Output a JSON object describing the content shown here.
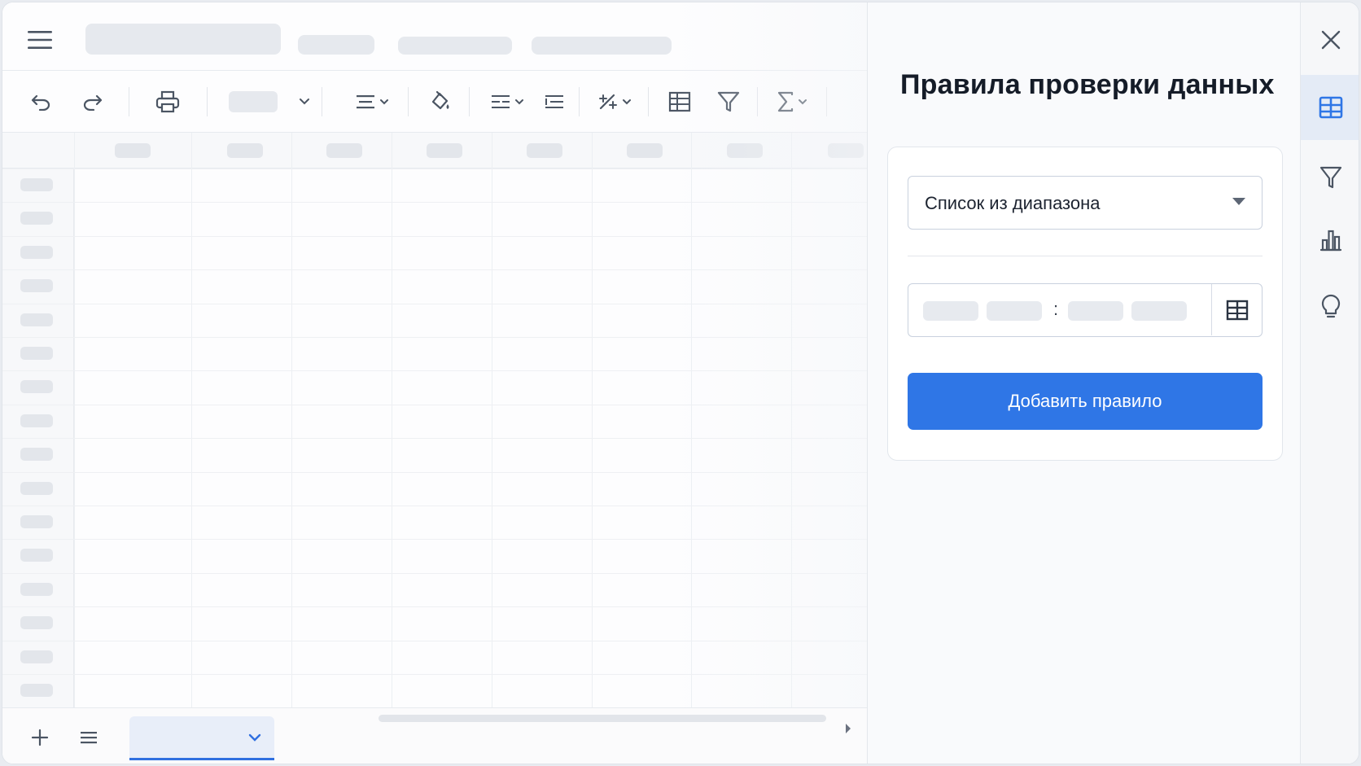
{
  "panel": {
    "title": "Правила проверки данных",
    "criteria_dropdown": {
      "selected": "Список из диапазона"
    },
    "range_field": {
      "separator": ":"
    },
    "add_rule_label": "Добавить правило"
  },
  "toolbar": {
    "icons": [
      "undo-icon",
      "redo-icon",
      "print-icon",
      "align-icon",
      "fill-color-icon",
      "wrap-text-icon",
      "indent-icon",
      "text-rotation-icon",
      "table-icon",
      "filter-icon",
      "sum-icon"
    ]
  },
  "rail": {
    "items": [
      "close-icon",
      "table-icon",
      "filter-icon",
      "chart-icon",
      "lightbulb-icon"
    ],
    "active": "table-icon"
  },
  "colors": {
    "accent": "#2f76e6",
    "active_rail_bg": "#e4ebf6",
    "icon": "#4b5563"
  }
}
